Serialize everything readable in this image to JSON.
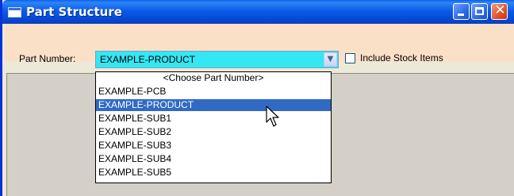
{
  "window": {
    "title": "Part Structure",
    "controls": {
      "minimize": "minimize",
      "maximize": "maximize",
      "close": "close"
    }
  },
  "toolbar": {
    "part_number_label": "Part Number:",
    "part_number_value": "EXAMPLE-PRODUCT",
    "include_stock_label": "Include Stock Items",
    "include_stock_checked": false
  },
  "dropdown": {
    "items": [
      "<Choose Part Number>",
      "EXAMPLE-PCB",
      "EXAMPLE-PRODUCT",
      "EXAMPLE-SUB1",
      "EXAMPLE-SUB2",
      "EXAMPLE-SUB3",
      "EXAMPLE-SUB4",
      "EXAMPLE-SUB5"
    ],
    "selected_index": 2
  },
  "colors": {
    "titlebar": "#0a5fe8",
    "toolbar_bg": "#fbe0c8",
    "combo_bg": "#33e7f5",
    "selection": "#316ac5"
  }
}
